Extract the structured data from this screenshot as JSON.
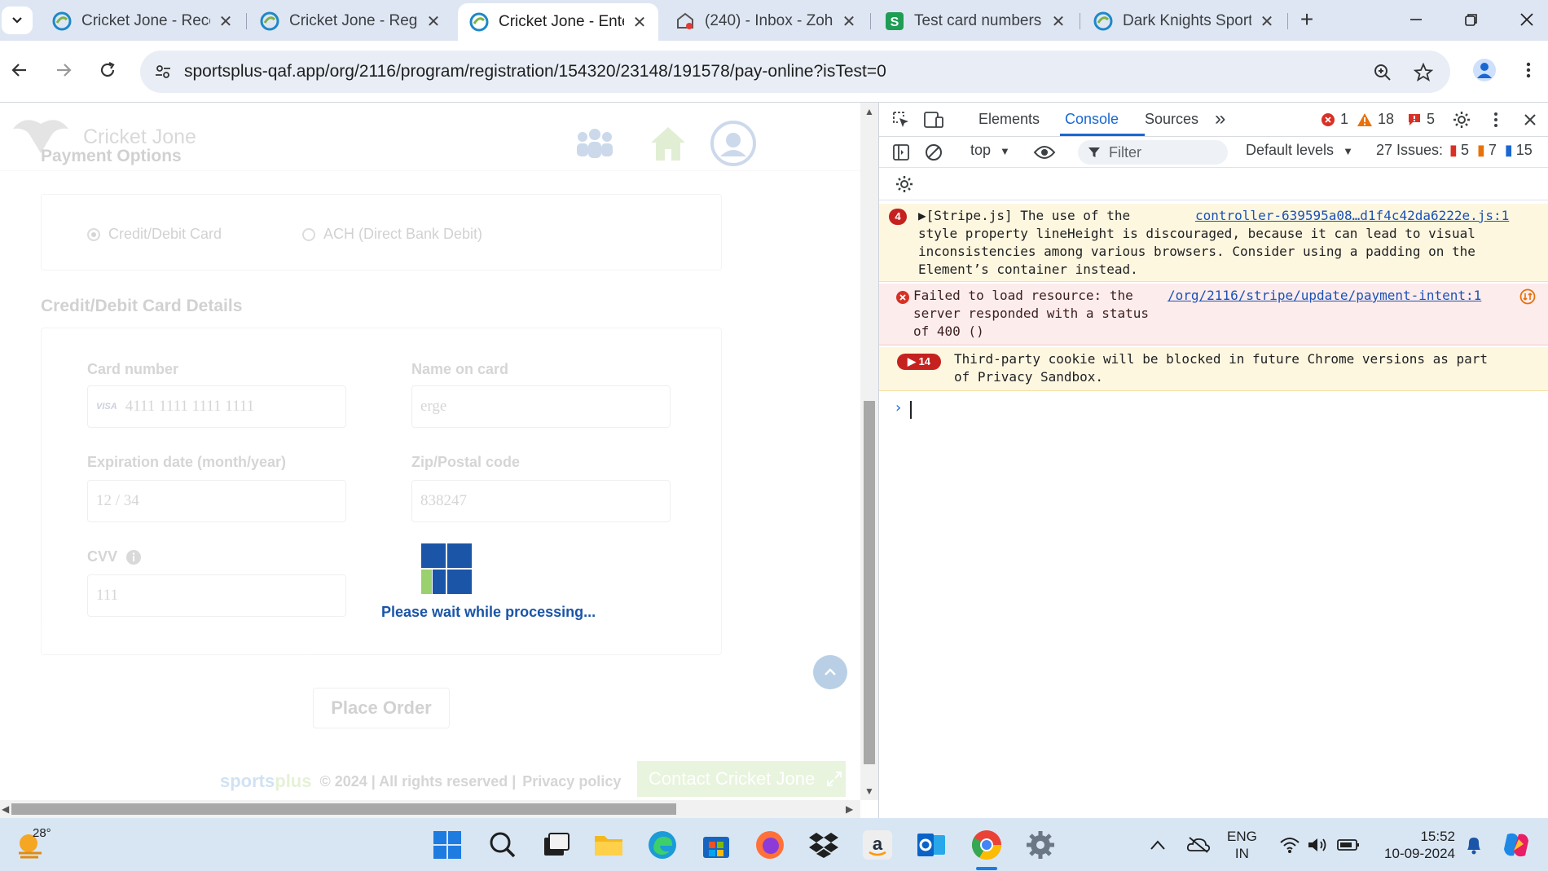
{
  "browser": {
    "tabs": [
      {
        "title": "Cricket Jone - Rece",
        "favicon": "sportsplus-icon"
      },
      {
        "title": "Cricket Jone - Regi",
        "favicon": "sportsplus-icon"
      },
      {
        "title": "Cricket Jone - Ente",
        "favicon": "sportsplus-icon"
      },
      {
        "title": "(240) - Inbox - Zoh",
        "favicon": "zoho-mail-icon"
      },
      {
        "title": "Test card numbers",
        "favicon": "stripe-icon"
      },
      {
        "title": "Dark Knights Sport",
        "favicon": "sportsplus-icon"
      }
    ],
    "new_tab_label": "+",
    "url": "sportsplus-qaf.app/org/2116/program/registration/154320/23148/191578/pay-online?isTest=0"
  },
  "page": {
    "brand_name": "Cricket Jone",
    "payment_options_title": "Payment Options",
    "payment_methods": [
      {
        "label": "Credit/Debit Card",
        "selected": true
      },
      {
        "label": "ACH (Direct Bank Debit)",
        "selected": false
      }
    ],
    "card_details_title": "Credit/Debit Card Details",
    "fields": {
      "card_number": {
        "label": "Card number",
        "value": "4111 1111 1111 1111",
        "brand": "VISA"
      },
      "name_on_card": {
        "label": "Name on card",
        "value": "erge"
      },
      "expiration": {
        "label": "Expiration date (month/year)",
        "value": "12 / 34"
      },
      "postal_code": {
        "label": "Zip/Postal code",
        "value": "838247"
      },
      "cvv": {
        "label": "CVV",
        "value": "111"
      }
    },
    "place_order_label": "Place Order",
    "loading_text": "Please wait while processing...",
    "footer": {
      "brand_left": "sports",
      "brand_right": "plus",
      "copyright": "© 2024 | All rights reserved |",
      "privacy": "Privacy policy",
      "contact": "Contact Cricket Jone"
    }
  },
  "devtools": {
    "tabs": [
      "Elements",
      "Console",
      "Sources"
    ],
    "active_tab": "Console",
    "more_tabs": "»",
    "errors_count": "1",
    "warnings_count": "18",
    "info_count": "5",
    "context": "top",
    "filter_placeholder": "Filter",
    "levels_label": "Default levels",
    "issues_label": "27 Issues:",
    "issues_errors": "5",
    "issues_warnings": "7",
    "issues_info": "15",
    "messages": [
      {
        "type": "warning",
        "count": "4",
        "text": "▶[Stripe.js] The use of the       \nstyle property lineHeight is discouraged, because it can lead to visual\ninconsistencies among various browsers. Consider using a padding on the\nElement’s container instead.",
        "source": "controller-639595a08…d1f4c42da6222e.js:1"
      },
      {
        "type": "error",
        "text": "Failed to load resource: the\nserver responded with a status\nof 400 ()",
        "source": "/org/2116/stripe/update/payment-intent:1"
      },
      {
        "type": "warning",
        "count": "▶ 14",
        "text": "Third-party cookie will be blocked in future Chrome versions as part\nof Privacy Sandbox."
      }
    ],
    "prompt": "›"
  },
  "taskbar": {
    "temperature": "28°",
    "language_top": "ENG",
    "language_bottom": "IN",
    "time": "15:52",
    "date": "10-09-2024"
  },
  "colors": {
    "accent": "#1a67d2",
    "error": "#d93025",
    "warning": "#e8710a",
    "sportsplus_blue": "#2f7ec7",
    "sportsplus_green": "#8bc34a"
  }
}
